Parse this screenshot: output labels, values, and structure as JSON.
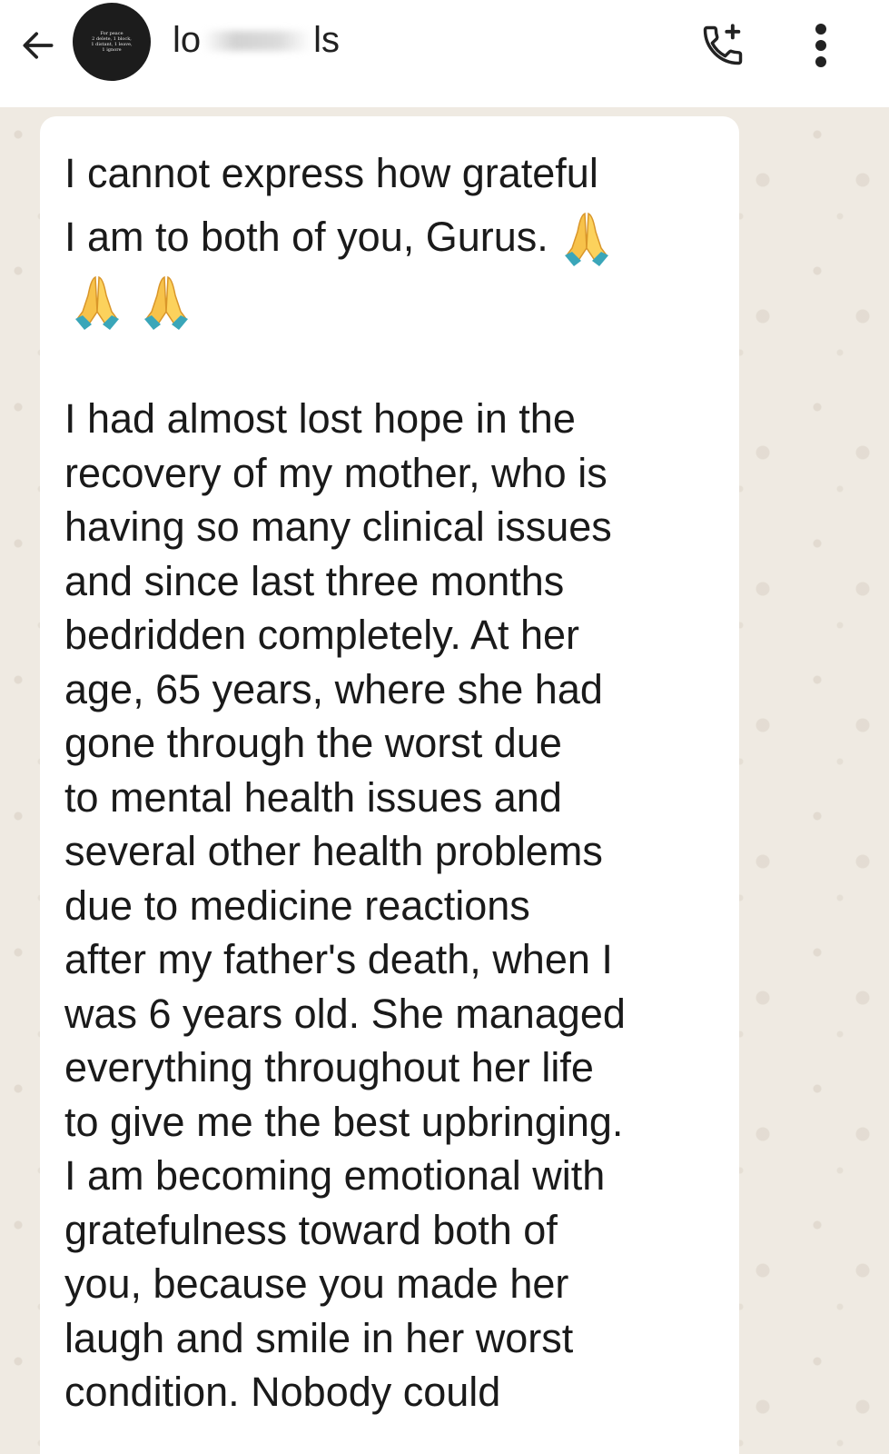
{
  "header": {
    "back_icon": "arrow-left-icon",
    "avatar_text": "For peace\n2 delete, 1 block,\n1 distant, 1 leave,\n1 ignore",
    "name_start": "lo",
    "name_end": "ls",
    "call_icon": "add-call-icon",
    "menu_icon": "more-vertical-icon"
  },
  "message": {
    "paragraph1_lines": [
      "I cannot express how grateful",
      "I am to both of you, Gurus. "
    ],
    "emoji_icon": "folded-hands-emoji",
    "emoji_inline_count": 1,
    "emoji_row_count": 2,
    "paragraph2_lines": [
      "I had almost lost hope in the",
      "recovery of my mother, who is",
      "having so many clinical issues",
      "and since last three months",
      "bedridden completely. At her",
      "age, 65 years, where she had",
      "gone through the worst due",
      "to mental health issues and",
      "several other health problems",
      "due to medicine reactions",
      "after my father's death, when I",
      "was 6 years old. She managed",
      "everything throughout her life",
      "to give me the best upbringing.",
      "I am becoming emotional with",
      "gratefulness toward both of",
      "you, because you made her",
      "laugh and smile in her worst",
      "condition. Nobody could"
    ]
  },
  "colors": {
    "chat_background": "#efeae2",
    "bubble": "#ffffff",
    "text": "#1a1a1a",
    "avatar": "#1c1c1c"
  }
}
